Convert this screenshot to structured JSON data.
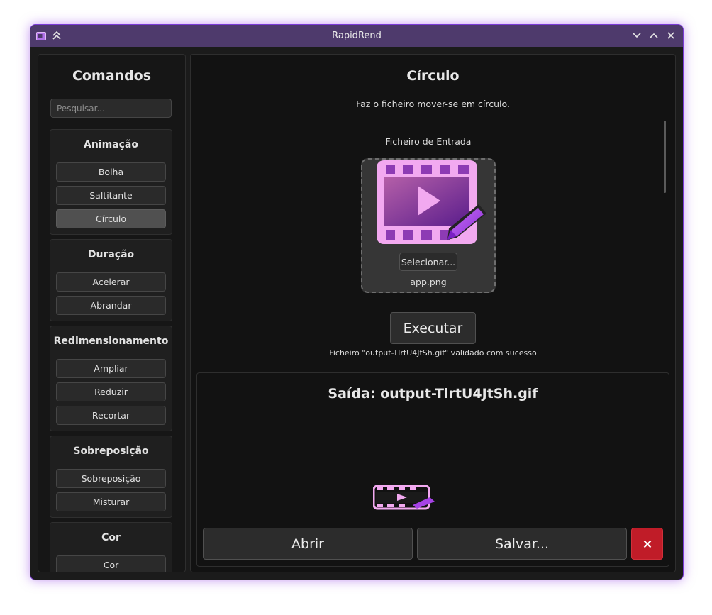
{
  "window": {
    "title": "RapidRend"
  },
  "sidebar": {
    "title": "Comandos",
    "search_placeholder": "Pesquisar...",
    "sections": [
      {
        "title": "Animação",
        "items": [
          "Bolha",
          "Saltitante",
          "Círculo"
        ],
        "active_item": "Círculo"
      },
      {
        "title": "Duração",
        "items": [
          "Acelerar",
          "Abrandar"
        ]
      },
      {
        "title": "Redimensionamento",
        "items": [
          "Ampliar",
          "Reduzir",
          "Recortar"
        ]
      },
      {
        "title": "Sobreposição",
        "items": [
          "Sobreposição",
          "Misturar"
        ]
      },
      {
        "title": "Cor",
        "items": [
          "Cor"
        ]
      }
    ]
  },
  "main": {
    "title": "Círculo",
    "description": "Faz o ficheiro mover-se em círculo.",
    "input_label": "Ficheiro de Entrada",
    "select_label": "Selecionar...",
    "filename": "app.png",
    "run_label": "Executar",
    "status": "Ficheiro \"output-TlrtU4JtSh.gif\" validado com sucesso",
    "output": {
      "title": "Saída: output-TlrtU4JtSh.gif",
      "open_label": "Abrir",
      "save_label": "Salvar..."
    }
  },
  "colors": {
    "titlebar": "#4e3a6c",
    "window_border": "#7b3bd6",
    "close_button": "#c01c28",
    "icon_pink": "#f2a9f0",
    "icon_purple": "#a642e6"
  },
  "icons": {
    "app_icon": "app-icon",
    "keep_above": "double-chevron-up-icon",
    "minimize": "chevron-down-icon",
    "maximize": "chevron-up-icon",
    "close": "close-icon",
    "input_preview": "video-edit-icon",
    "output_preview": "video-edit-icon",
    "dismiss": "close-icon"
  }
}
